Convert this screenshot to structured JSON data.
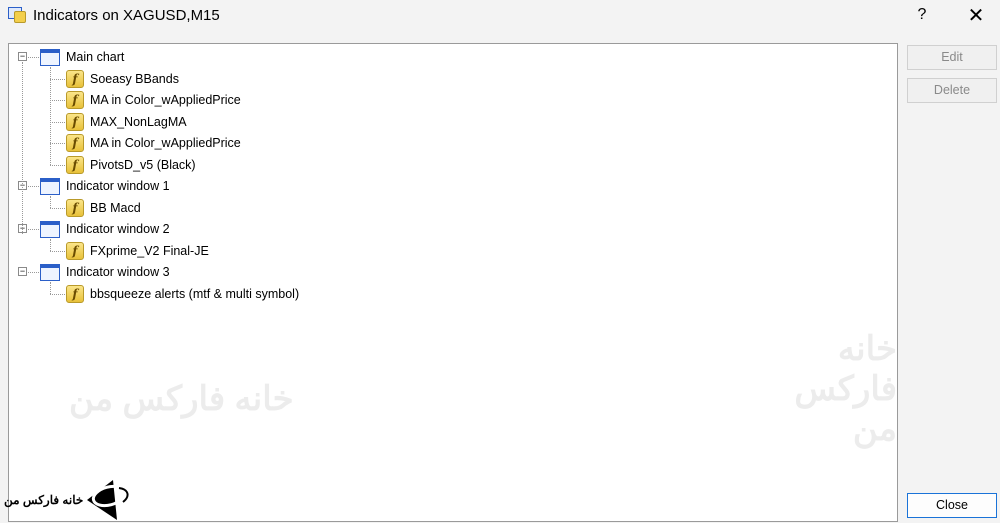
{
  "window": {
    "title": "Indicators on XAGUSD,M15",
    "help": "?",
    "close": "✕"
  },
  "tree": [
    {
      "label": "Main chart",
      "children": [
        "Soeasy BBands",
        "MA in Color_wAppliedPrice",
        "MAX_NonLagMA",
        "MA in Color_wAppliedPrice",
        "PivotsD_v5 (Black)"
      ]
    },
    {
      "label": "Indicator window 1",
      "children": [
        "BB Macd"
      ]
    },
    {
      "label": "Indicator window 2",
      "children": [
        "FXprime_V2 Final-JE"
      ]
    },
    {
      "label": "Indicator window 3",
      "children": [
        "bbsqueeze alerts (mtf & multi symbol)"
      ]
    }
  ],
  "buttons": {
    "edit": "Edit",
    "delete": "Delete",
    "close": "Close"
  },
  "watermark": {
    "text": "خانه فارکس من"
  },
  "colors": {
    "accent": "#1a73d8",
    "window_icon": "#2b5fc8",
    "indicator_icon": "#e8c13a"
  }
}
